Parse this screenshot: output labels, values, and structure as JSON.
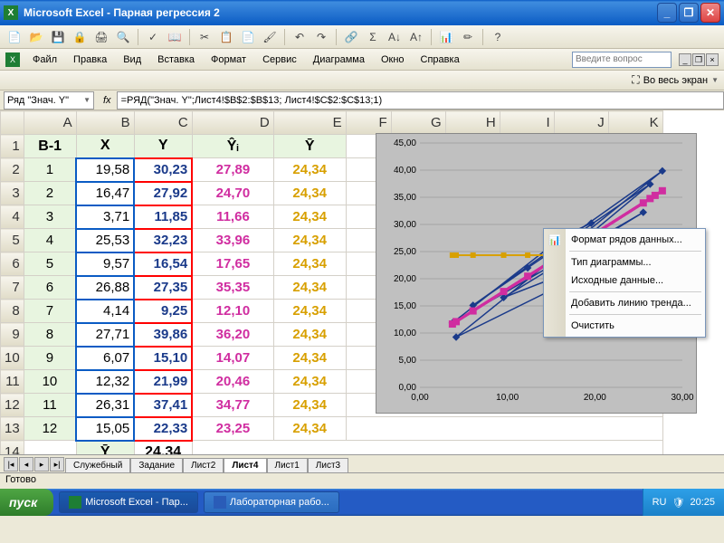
{
  "window": {
    "title": "Microsoft Excel - Парная регрессия 2",
    "min": "_",
    "max": "❐",
    "close": "✕"
  },
  "menu": {
    "m0": "Файл",
    "m1": "Правка",
    "m2": "Вид",
    "m3": "Вставка",
    "m4": "Формат",
    "m5": "Сервис",
    "m6": "Диаграмма",
    "m7": "Окно",
    "m8": "Справка",
    "question_placeholder": "Введите вопрос"
  },
  "fullscreen": {
    "label": "Во весь экран"
  },
  "namebox": {
    "value": "Ряд \"Знач. Y\""
  },
  "formula": {
    "fx": "fx",
    "value": "=РЯД(\"Знач. Y\";Лист4!$B$2:$B$13; Лист4!$C$2:$C$13;1)"
  },
  "cols": {
    "A": "A",
    "B": "B",
    "C": "C",
    "D": "D",
    "E": "E",
    "F": "F",
    "G": "G",
    "H": "H",
    "I": "I",
    "J": "J",
    "K": "K"
  },
  "headers": {
    "a": "В-1",
    "b": "X",
    "c": "Y",
    "d": "Ŷᵢ",
    "e": "Ȳ"
  },
  "rows": [
    {
      "n": "1",
      "b": "19,58",
      "c": "30,23",
      "d": "27,89",
      "e": "24,34"
    },
    {
      "n": "2",
      "b": "16,47",
      "c": "27,92",
      "d": "24,70",
      "e": "24,34"
    },
    {
      "n": "3",
      "b": "3,71",
      "c": "11,85",
      "d": "11,66",
      "e": "24,34"
    },
    {
      "n": "4",
      "b": "25,53",
      "c": "32,23",
      "d": "33,96",
      "e": "24,34"
    },
    {
      "n": "5",
      "b": "9,57",
      "c": "16,54",
      "d": "17,65",
      "e": "24,34"
    },
    {
      "n": "6",
      "b": "26,88",
      "c": "27,35",
      "d": "35,35",
      "e": "24,34"
    },
    {
      "n": "7",
      "b": "4,14",
      "c": "9,25",
      "d": "12,10",
      "e": "24,34"
    },
    {
      "n": "8",
      "b": "27,71",
      "c": "39,86",
      "d": "36,20",
      "e": "24,34"
    },
    {
      "n": "9",
      "b": "6,07",
      "c": "15,10",
      "d": "14,07",
      "e": "24,34"
    },
    {
      "n": "10",
      "b": "12,32",
      "c": "21,99",
      "d": "20,46",
      "e": "24,34"
    },
    {
      "n": "11",
      "b": "26,31",
      "c": "37,41",
      "d": "34,77",
      "e": "24,34"
    },
    {
      "n": "12",
      "b": "15,05",
      "c": "22,33",
      "d": "23,25",
      "e": "24,34"
    }
  ],
  "footer": {
    "b_lbl": "Ȳ",
    "c_val": "24,34"
  },
  "ctxmenu": {
    "i0": "Формат рядов данных...",
    "i1": "Тип диаграммы...",
    "i2": "Исходные данные...",
    "i3": "Добавить линию тренда...",
    "i4": "Очистить"
  },
  "sheets": {
    "s0": "Служебный",
    "s1": "Задание",
    "s2": "Лист2",
    "s3": "Лист4",
    "s4": "Лист1",
    "s5": "Лист3"
  },
  "status": {
    "ready": "Готово"
  },
  "taskbar": {
    "start": "пуск",
    "t0": "Microsoft Excel - Пар...",
    "t1": "Лабораторная рабо...",
    "lang": "RU",
    "time": "20:25"
  },
  "chart_data": {
    "type": "scatter",
    "title": "",
    "xlabel": "",
    "ylabel": "",
    "xlim": [
      0,
      30
    ],
    "ylim": [
      0,
      45
    ],
    "xticks": [
      "0,00",
      "10,00",
      "20,00",
      "30,00"
    ],
    "yticks": [
      "0,00",
      "5,00",
      "10,00",
      "15,00",
      "20,00",
      "25,00",
      "30,00",
      "35,00",
      "40,00",
      "45,00"
    ],
    "series": [
      {
        "name": "Знач. Y",
        "marker": "diamond",
        "color": "#1a3a8a",
        "x": [
          19.58,
          16.47,
          3.71,
          25.53,
          9.57,
          26.88,
          4.14,
          27.71,
          6.07,
          12.32,
          26.31,
          15.05
        ],
        "y": [
          30.23,
          27.92,
          11.85,
          32.23,
          16.54,
          27.35,
          9.25,
          39.86,
          15.1,
          21.99,
          37.41,
          22.33
        ]
      },
      {
        "name": "Ŷ",
        "marker": "square",
        "color": "#d02da0",
        "x": [
          19.58,
          16.47,
          3.71,
          25.53,
          9.57,
          26.88,
          4.14,
          27.71,
          6.07,
          12.32,
          26.31,
          15.05
        ],
        "y": [
          27.89,
          24.7,
          11.66,
          33.96,
          17.65,
          35.35,
          12.1,
          36.2,
          14.07,
          20.46,
          34.77,
          23.25
        ]
      },
      {
        "name": "Ȳ",
        "marker": "triangle",
        "color": "#d8a000",
        "x": [
          19.58,
          16.47,
          3.71,
          25.53,
          9.57,
          26.88,
          4.14,
          27.71,
          6.07,
          12.32,
          26.31,
          15.05
        ],
        "y": [
          24.34,
          24.34,
          24.34,
          24.34,
          24.34,
          24.34,
          24.34,
          24.34,
          24.34,
          24.34,
          24.34,
          24.34
        ]
      }
    ]
  }
}
